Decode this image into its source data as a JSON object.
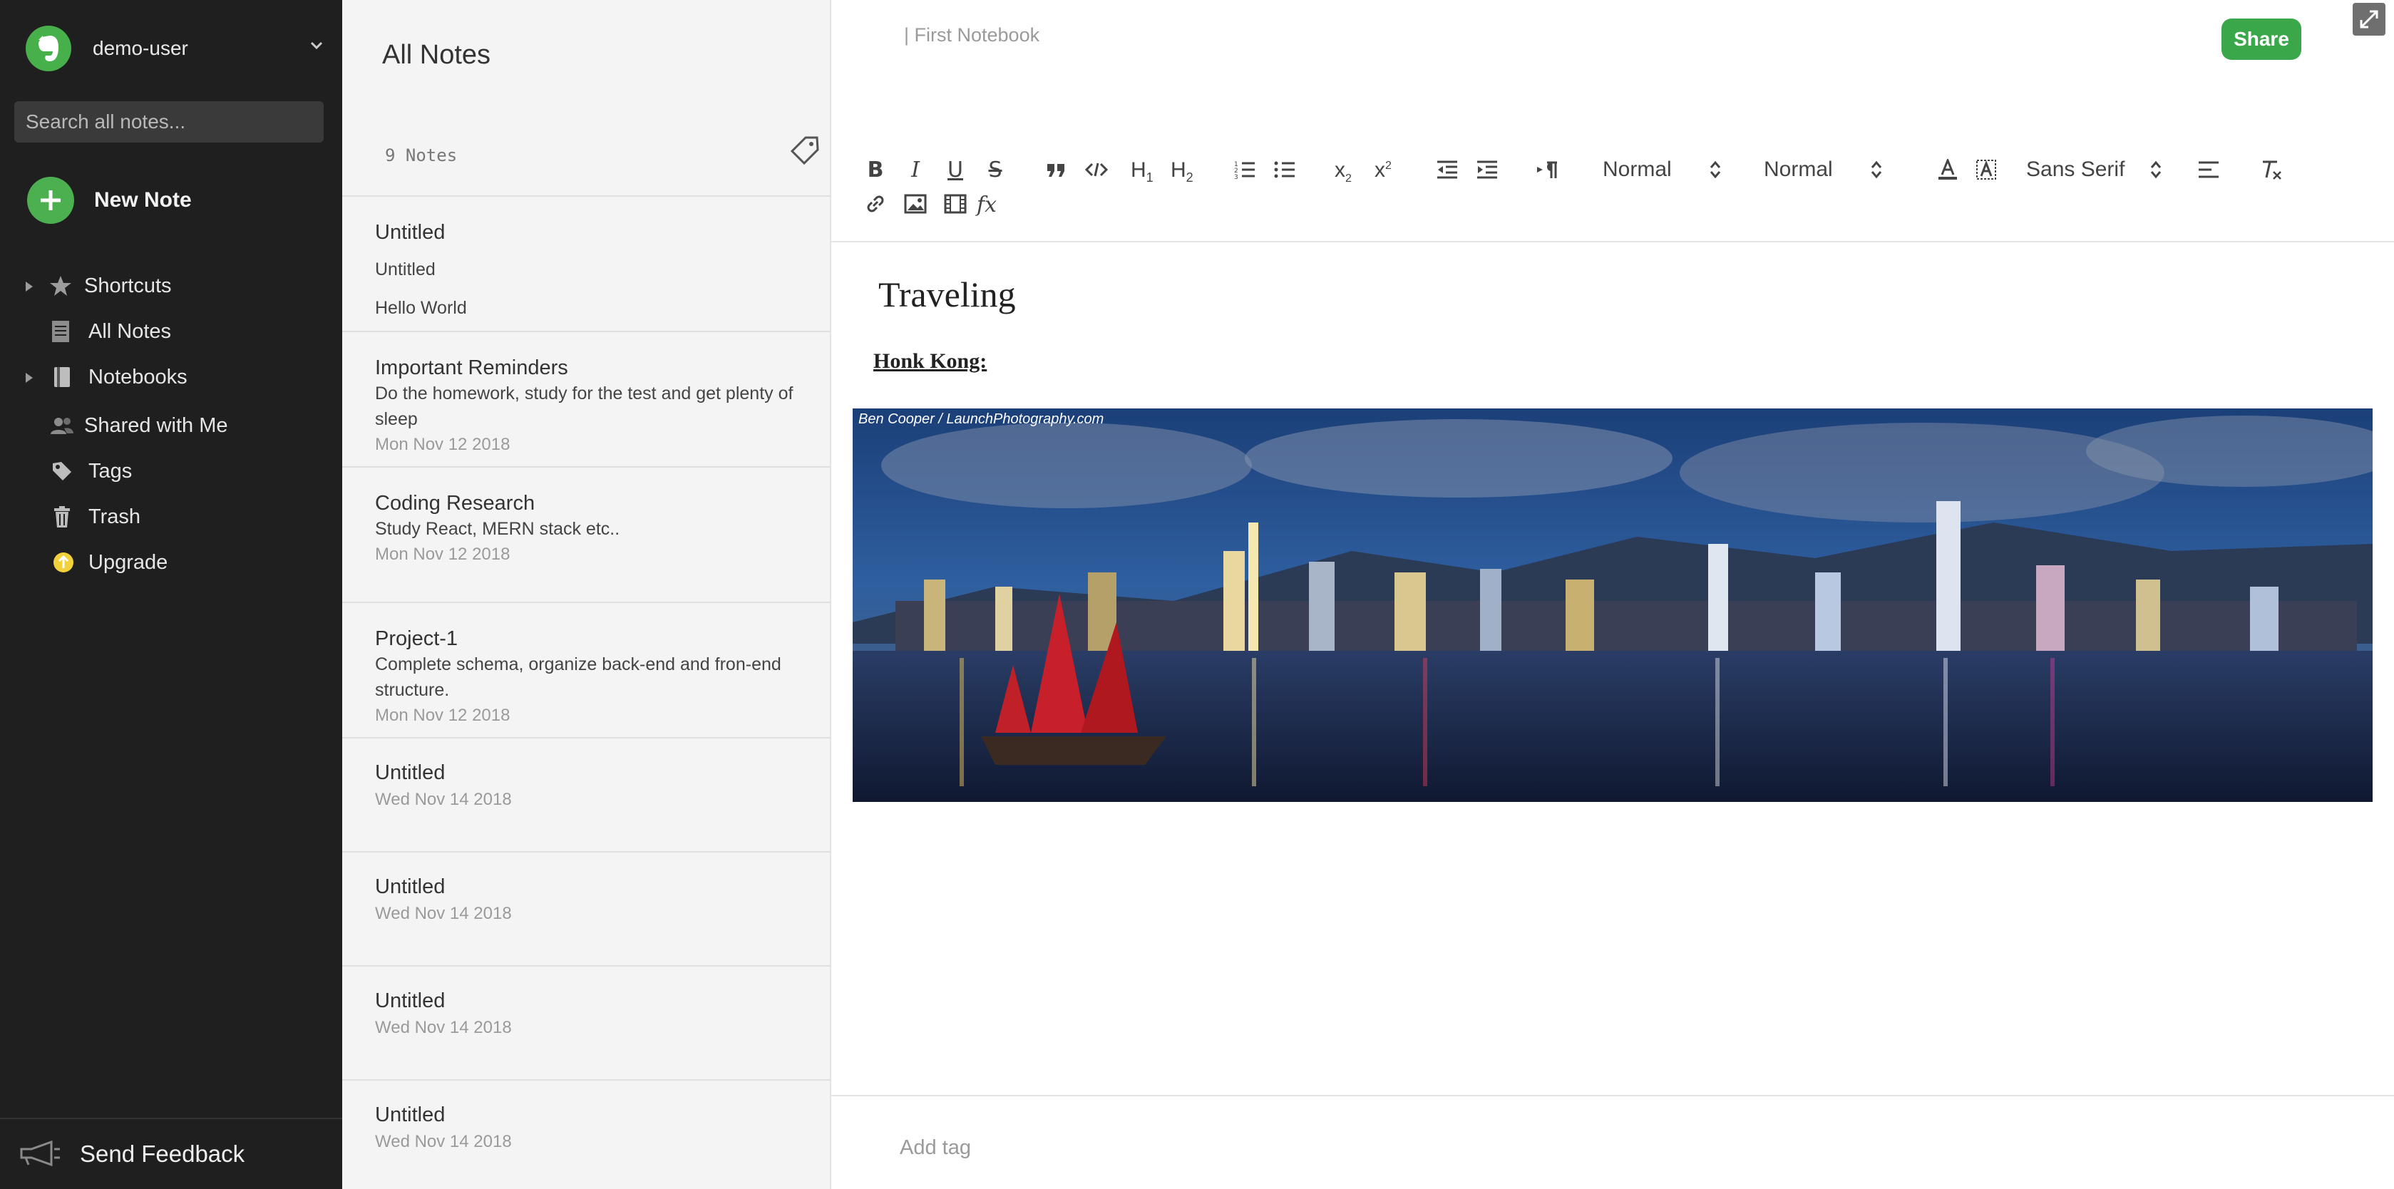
{
  "sidebar": {
    "username": "demo-user",
    "search_placeholder": "Search all notes...",
    "new_note_label": "New Note",
    "items": [
      {
        "label": "Shortcuts",
        "icon": "star-icon",
        "expandable": true
      },
      {
        "label": "All Notes",
        "icon": "document-icon",
        "expandable": false
      },
      {
        "label": "Notebooks",
        "icon": "notebook-icon",
        "expandable": true
      },
      {
        "label": "Shared with Me",
        "icon": "people-icon",
        "expandable": false
      },
      {
        "label": "Tags",
        "icon": "tag-icon",
        "expandable": false
      },
      {
        "label": "Trash",
        "icon": "trash-icon",
        "expandable": false
      },
      {
        "label": "Upgrade",
        "icon": "upgrade-icon",
        "expandable": false
      }
    ],
    "feedback_label": "Send Feedback"
  },
  "notes_list": {
    "title": "All Notes",
    "count_label": "9 Notes",
    "notes": [
      {
        "title": "Untitled",
        "lines": [
          "Untitled",
          "Hello World"
        ],
        "date": ""
      },
      {
        "title": "Important Reminders",
        "body": "Do the homework, study for the test and get plenty of sleep",
        "date": "Mon Nov 12 2018"
      },
      {
        "title": "Coding Research",
        "body": "Study React, MERN stack etc..",
        "date": "Mon Nov 12 2018"
      },
      {
        "title": "Project-1",
        "body": "Complete schema, organize back-end and fron-end structure.",
        "date": "Mon Nov 12 2018"
      },
      {
        "title": "Untitled",
        "body": "",
        "date": "Wed Nov 14 2018"
      },
      {
        "title": "Untitled",
        "body": "",
        "date": "Wed Nov 14 2018"
      },
      {
        "title": "Untitled",
        "body": "",
        "date": "Wed Nov 14 2018"
      },
      {
        "title": "Untitled",
        "body": "",
        "date": "Wed Nov 14 2018"
      }
    ]
  },
  "editor": {
    "notebook_label": "| First Notebook",
    "share_label": "Share",
    "toolbar": {
      "header_select": "Normal",
      "size_select": "Normal",
      "font_select": "Sans Serif"
    },
    "title": "Traveling",
    "subtitle": "Honk Kong:",
    "image_credit": "Ben Cooper / LaunchPhotography.com",
    "tag_placeholder": "Add tag"
  },
  "colors": {
    "sidebar_bg": "#1f1f1f",
    "accent_green": "#3aa84a",
    "notes_bg": "#f4f4f4"
  }
}
